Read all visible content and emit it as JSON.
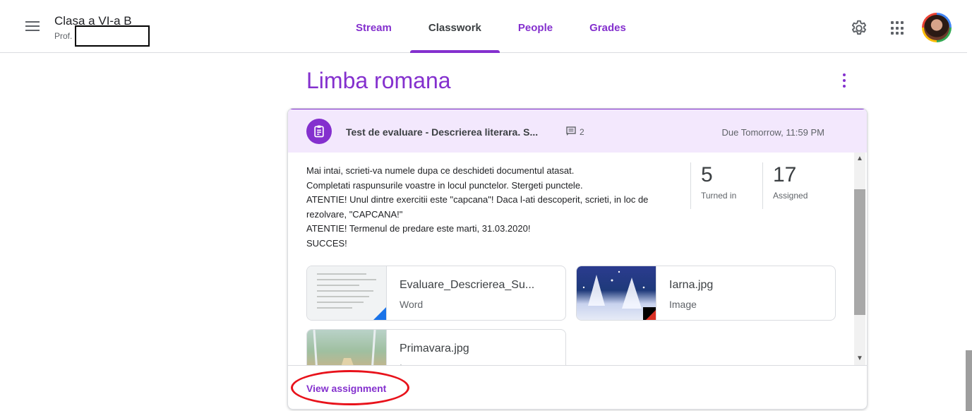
{
  "header": {
    "class_title": "Clasa a VI-a B",
    "class_sub": "Prof.",
    "tabs": [
      {
        "label": "Stream",
        "active": false
      },
      {
        "label": "Classwork",
        "active": true
      },
      {
        "label": "People",
        "active": false
      },
      {
        "label": "Grades",
        "active": false
      }
    ],
    "icons": {
      "menu": "hamburger-icon",
      "settings": "gear-icon",
      "apps": "apps-grid-icon",
      "account": "avatar"
    }
  },
  "topic": {
    "title": "Limba romana"
  },
  "assignment": {
    "title": "Test de evaluare - Descrierea literara. S...",
    "comment_count": "2",
    "due": "Due Tomorrow, 11:59 PM",
    "description": [
      "Mai intai, scrieti-va numele dupa ce deschideti documentul atasat.",
      "Completati raspunsurile voastre in locul punctelor. Stergeti punctele.",
      "ATENTIE! Unul dintre exercitii este \"capcana\"! Daca l-ati descoperit, scrieti, in loc de rezolvare, \"CAPCANA!\"",
      "ATENTIE! Termenul de predare este marti, 31.03.2020!",
      "SUCCES!"
    ],
    "stats": [
      {
        "value": "5",
        "label": "Turned in"
      },
      {
        "value": "17",
        "label": "Assigned"
      }
    ],
    "attachments": [
      {
        "name": "Evaluare_Descrierea_Su...",
        "type": "Word"
      },
      {
        "name": "Iarna.jpg",
        "type": "Image"
      },
      {
        "name": "Primavara.jpg",
        "type": "Image"
      }
    ],
    "view_label": "View assignment"
  },
  "colors": {
    "accent": "#8430ce",
    "header_bg": "#f3e8fd",
    "annotation": "#e8121b"
  }
}
